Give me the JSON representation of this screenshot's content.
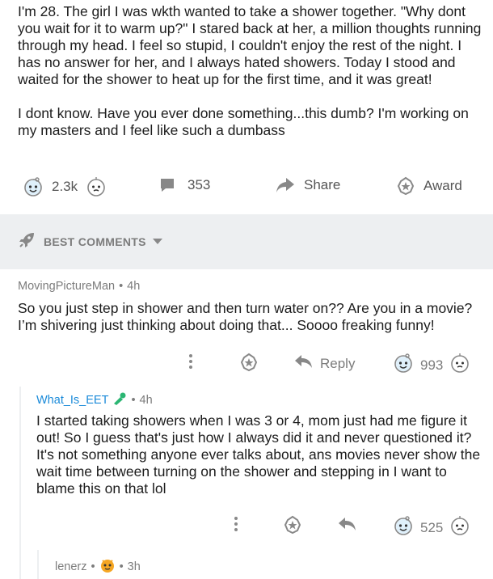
{
  "post": {
    "paragraphs": [
      "I'm 28. The girl I was wkth wanted to take a shower together. \"Why dont you wait for it to warm up?\"  I stared back at her, a million thoughts running through my head. I feel so stupid, I couldn't enjoy the rest of the night. I has no answer for her, and I always hated showers. Today I stood and waited for the shower to heat up for the first time, and it was great!",
      "I dont know. Have you ever done something...this dumb? I'm working on my masters and I feel like such a dumbass"
    ],
    "votes": "2.3k",
    "comments": "353",
    "share_label": "Share",
    "award_label": "Award"
  },
  "sort": {
    "label": "BEST COMMENTS"
  },
  "comments": [
    {
      "author": "MovingPictureMan",
      "age": "4h",
      "text": "So you just step in shower and then turn water on?? Are you in a movie? I’m shivering just thinking about doing that... Soooo freaking funny!",
      "reply_label": "Reply",
      "votes": "993"
    },
    {
      "author": "What_Is_EET",
      "age": "4h",
      "text": "I started taking showers when I was 3 or 4, mom just had me figure it out! So I guess that's just how I always did it and never questioned it? It's not something anyone ever talks about, ans movies never show the wait time between turning on the shower and stepping in  I want to blame this on that lol",
      "votes": "525"
    },
    {
      "author": "lenerz",
      "age": "3h"
    }
  ],
  "colors": {
    "accent": "#1a8ad9",
    "muted": "#7c7c7c",
    "band": "#edeff1"
  },
  "icons": [
    "upvote-icon",
    "downvote-icon",
    "comment-icon",
    "share-icon",
    "award-icon",
    "rocket-icon",
    "chevron-down-icon",
    "more-icon",
    "reply-icon",
    "flair-icon"
  ]
}
